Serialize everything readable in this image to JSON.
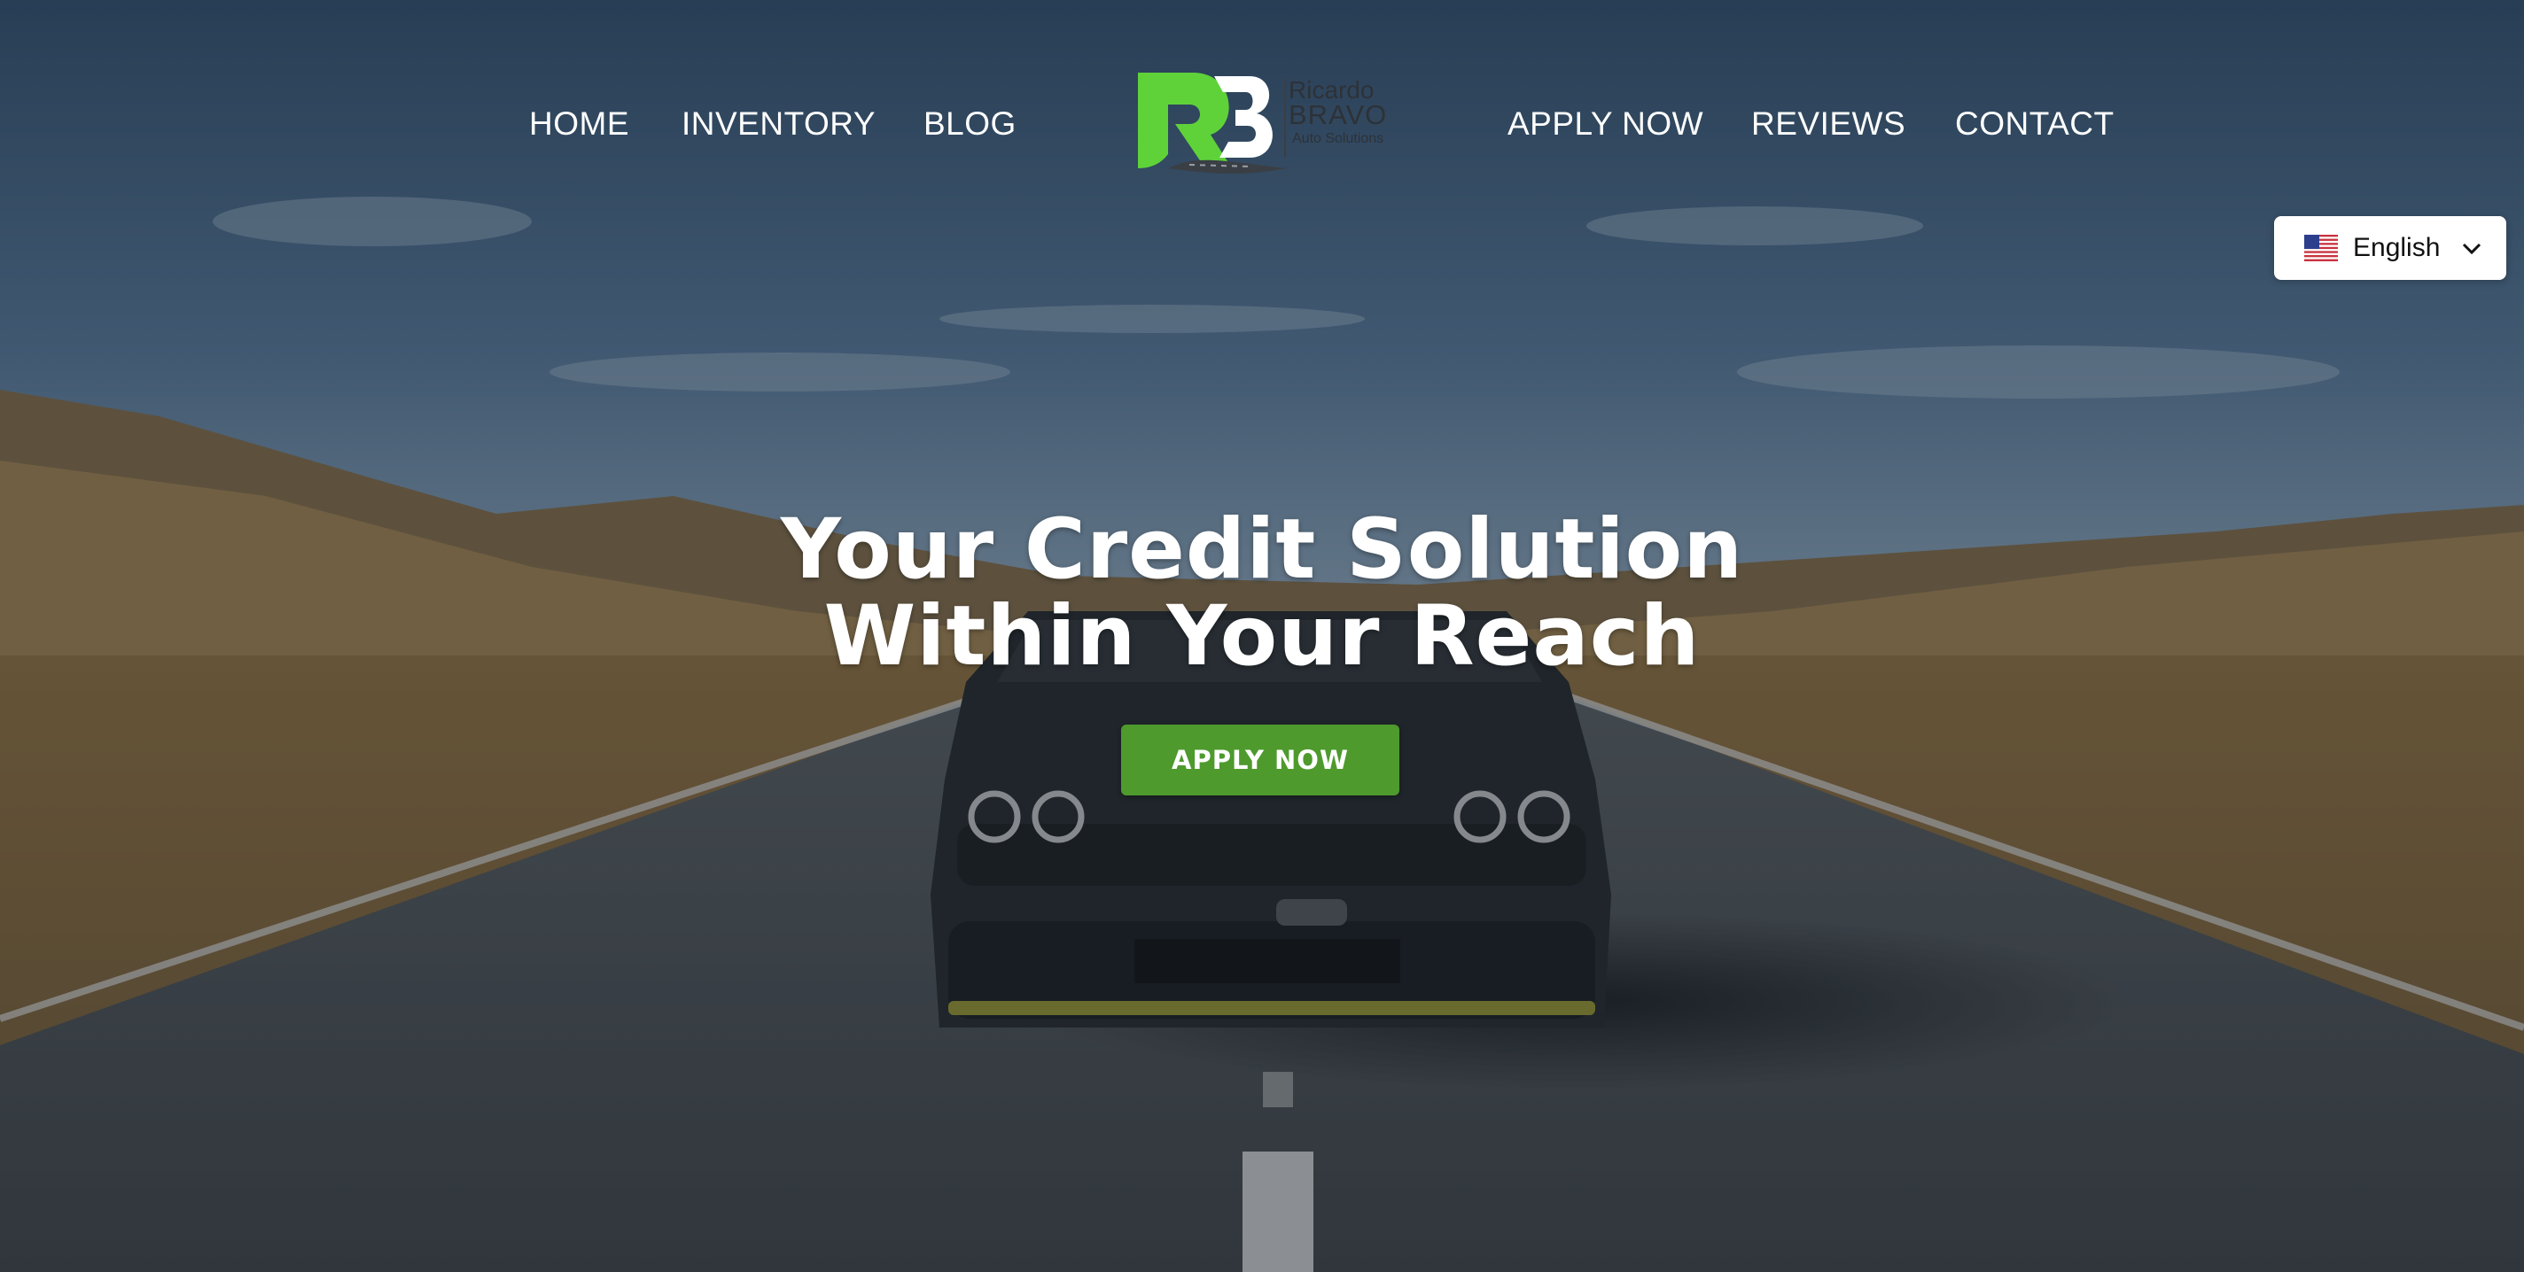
{
  "nav": {
    "left": [
      "HOME",
      "INVENTORY",
      "BLOG"
    ],
    "right": [
      "APPLY NOW",
      "REVIEWS",
      "CONTACT"
    ]
  },
  "logo": {
    "monogram": "RB",
    "line1": "Ricardo",
    "line2": "BRAVO",
    "line3": "Auto Solutions",
    "colors": {
      "green": "#5fd23a",
      "gray": "#3a3f45"
    }
  },
  "language": {
    "selected": "English",
    "flag_icon": "us-flag-icon"
  },
  "hero": {
    "headline_line1": "Your Credit Solution",
    "headline_line2": "Within Your Reach",
    "cta_label": "APPLY NOW"
  },
  "colors": {
    "cta": "#4e9a2d",
    "overlay": "#1a2633"
  }
}
